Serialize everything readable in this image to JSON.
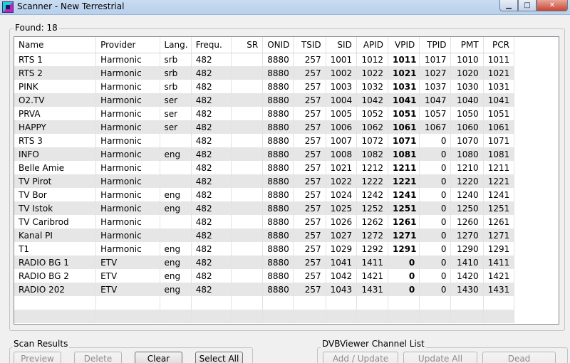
{
  "window": {
    "title": "Scanner - New Terrestrial",
    "minimize": "▁",
    "maximize": "□",
    "close": "✕"
  },
  "found": {
    "label": "Found:",
    "count": "18"
  },
  "columns": [
    "Name",
    "Provider",
    "Lang.",
    "Frequ.",
    "SR",
    "ONID",
    "TSID",
    "SID",
    "APID",
    "VPID",
    "TPID",
    "PMT",
    "PCR"
  ],
  "rows": [
    [
      "RTS 1",
      "Harmonic",
      "srb",
      "482",
      "",
      "8880",
      "257",
      "1001",
      "1012",
      "1011",
      "1017",
      "1010",
      "1011"
    ],
    [
      "RTS 2",
      "Harmonic",
      "srb",
      "482",
      "",
      "8880",
      "257",
      "1002",
      "1022",
      "1021",
      "1027",
      "1020",
      "1021"
    ],
    [
      "PINK",
      "Harmonic",
      "srb",
      "482",
      "",
      "8880",
      "257",
      "1003",
      "1032",
      "1031",
      "1037",
      "1030",
      "1031"
    ],
    [
      "O2.TV",
      "Harmonic",
      "ser",
      "482",
      "",
      "8880",
      "257",
      "1004",
      "1042",
      "1041",
      "1047",
      "1040",
      "1041"
    ],
    [
      "PRVA",
      "Harmonic",
      "ser",
      "482",
      "",
      "8880",
      "257",
      "1005",
      "1052",
      "1051",
      "1057",
      "1050",
      "1051"
    ],
    [
      "HAPPY",
      "Harmonic",
      "ser",
      "482",
      "",
      "8880",
      "257",
      "1006",
      "1062",
      "1061",
      "1067",
      "1060",
      "1061"
    ],
    [
      "RTS 3",
      "Harmonic",
      "",
      "482",
      "",
      "8880",
      "257",
      "1007",
      "1072",
      "1071",
      "0",
      "1070",
      "1071"
    ],
    [
      "INFO",
      "Harmonic",
      "eng",
      "482",
      "",
      "8880",
      "257",
      "1008",
      "1082",
      "1081",
      "0",
      "1080",
      "1081"
    ],
    [
      "Belle Amie",
      "Harmonic",
      "",
      "482",
      "",
      "8880",
      "257",
      "1021",
      "1212",
      "1211",
      "0",
      "1210",
      "1211"
    ],
    [
      "TV Pirot",
      "Harmonic",
      "",
      "482",
      "",
      "8880",
      "257",
      "1022",
      "1222",
      "1221",
      "0",
      "1220",
      "1221"
    ],
    [
      "TV Bor",
      "Harmonic",
      "eng",
      "482",
      "",
      "8880",
      "257",
      "1024",
      "1242",
      "1241",
      "0",
      "1240",
      "1241"
    ],
    [
      "TV Istok",
      "Harmonic",
      "eng",
      "482",
      "",
      "8880",
      "257",
      "1025",
      "1252",
      "1251",
      "0",
      "1250",
      "1251"
    ],
    [
      "TV Caribrod",
      "Harmonic",
      "",
      "482",
      "",
      "8880",
      "257",
      "1026",
      "1262",
      "1261",
      "0",
      "1260",
      "1261"
    ],
    [
      "Kanal PI",
      "Harmonic",
      "",
      "482",
      "",
      "8880",
      "257",
      "1027",
      "1272",
      "1271",
      "0",
      "1270",
      "1271"
    ],
    [
      "T1",
      "Harmonic",
      "eng",
      "482",
      "",
      "8880",
      "257",
      "1029",
      "1292",
      "1291",
      "0",
      "1290",
      "1291"
    ],
    [
      "RADIO BG 1",
      "ETV",
      "eng",
      "482",
      "",
      "8880",
      "257",
      "1041",
      "1411",
      "0",
      "0",
      "1410",
      "1411"
    ],
    [
      "RADIO BG 2",
      "ETV",
      "eng",
      "482",
      "",
      "8880",
      "257",
      "1042",
      "1421",
      "0",
      "0",
      "1420",
      "1421"
    ],
    [
      "RADIO 202",
      "ETV",
      "eng",
      "482",
      "",
      "8880",
      "257",
      "1043",
      "1431",
      "0",
      "0",
      "1430",
      "1431"
    ]
  ],
  "scan_results": {
    "label": "Scan Results",
    "preview": "Preview",
    "delete": "Delete",
    "clear": "Clear",
    "select_all": "Select All"
  },
  "channel_list": {
    "label": "DVBViewer Channel List",
    "add_update": "Add / Update",
    "update_all": "Update All",
    "dead_channels": "Dead Channels..."
  }
}
